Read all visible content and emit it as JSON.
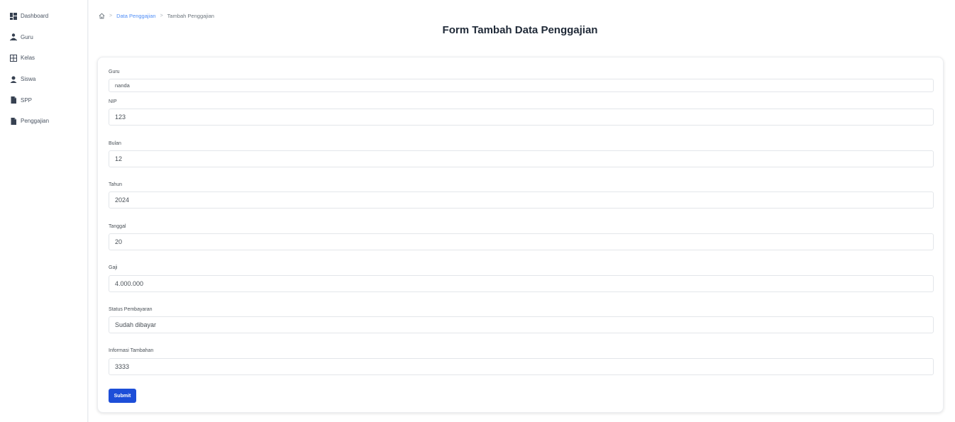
{
  "sidebar": {
    "items": [
      {
        "label": "Dashboard",
        "icon": "dashboard-icon"
      },
      {
        "label": "Guru",
        "icon": "teacher-icon"
      },
      {
        "label": "Kelas",
        "icon": "table-icon"
      },
      {
        "label": "Siswa",
        "icon": "user-icon"
      },
      {
        "label": "SPP",
        "icon": "file-icon"
      },
      {
        "label": "Penggajian",
        "icon": "file-icon"
      }
    ]
  },
  "breadcrumb": {
    "parent": "Data Penggajian",
    "current": "Tambah Penggajian"
  },
  "page_title": "Form Tambah Data Penggajian",
  "form": {
    "fields": [
      {
        "label": "Guru",
        "value": "nanda"
      },
      {
        "label": "NIP",
        "value": "123"
      },
      {
        "label": "Bulan",
        "value": "12"
      },
      {
        "label": "Tahun",
        "value": "2024"
      },
      {
        "label": "Tanggal",
        "value": "20"
      },
      {
        "label": "Gaji",
        "value": "4.000.000"
      },
      {
        "label": "Status Pembayaran",
        "value": "Sudah dibayar"
      },
      {
        "label": "Informasi Tambahan",
        "value": "3333"
      }
    ],
    "submit_label": "Submit"
  },
  "colors": {
    "accent": "#1d4ed8",
    "link": "#4f8ef7"
  }
}
